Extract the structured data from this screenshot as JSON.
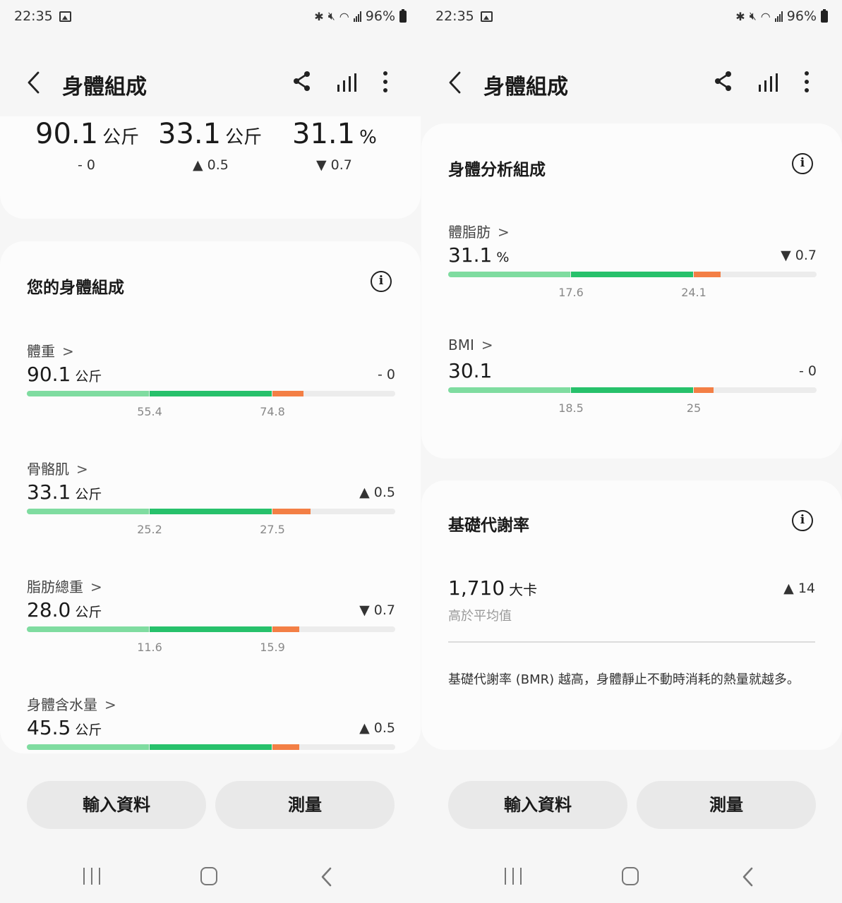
{
  "status": {
    "time": "22:35",
    "battery": "96%"
  },
  "appbar": {
    "title": "身體組成"
  },
  "summary": [
    {
      "value": "90.1",
      "unit": "公斤",
      "change": "- 0"
    },
    {
      "value": "33.1",
      "unit": "公斤",
      "change": "▲ 0.5"
    },
    {
      "value": "31.1",
      "unit": "%",
      "change": "▼ 0.7"
    }
  ],
  "left_card": {
    "title": "您的身體組成",
    "metrics": [
      {
        "label": "體重",
        "value": "90.1",
        "unit": "公斤",
        "change": "- 0",
        "ticks": [
          "55.4",
          "74.8"
        ],
        "level": 0.75
      },
      {
        "label": "骨骼肌",
        "value": "33.1",
        "unit": "公斤",
        "change": "▲ 0.5",
        "ticks": [
          "25.2",
          "27.5"
        ],
        "level": 0.77
      },
      {
        "label": "脂肪總重",
        "value": "28.0",
        "unit": "公斤",
        "change": "▼ 0.7",
        "ticks": [
          "11.6",
          "15.9"
        ],
        "level": 0.74
      },
      {
        "label": "身體含水量",
        "value": "45.5",
        "unit": "公斤",
        "change": "▲ 0.5",
        "ticks": [
          "",
          ""
        ],
        "level": 0.74
      }
    ]
  },
  "right_card": {
    "title": "身體分析組成",
    "metrics": [
      {
        "label": "體脂肪",
        "value": "31.1",
        "unit": "%",
        "change": "▼ 0.7",
        "ticks": [
          "17.6",
          "24.1"
        ],
        "level": 0.74
      },
      {
        "label": "BMI",
        "value": "30.1",
        "unit": "",
        "change": "- 0",
        "ticks": [
          "18.5",
          "25"
        ],
        "level": 0.72
      }
    ]
  },
  "bmr_card": {
    "title": "基礎代謝率",
    "value": "1,710",
    "unit": "大卡",
    "change": "▲ 14",
    "note": "高於平均值",
    "description": "基礎代謝率 (BMR) 越高，身體靜止不動時消耗的熱量就越多。"
  },
  "buttons": {
    "input": "輸入資料",
    "measure": "測量"
  }
}
